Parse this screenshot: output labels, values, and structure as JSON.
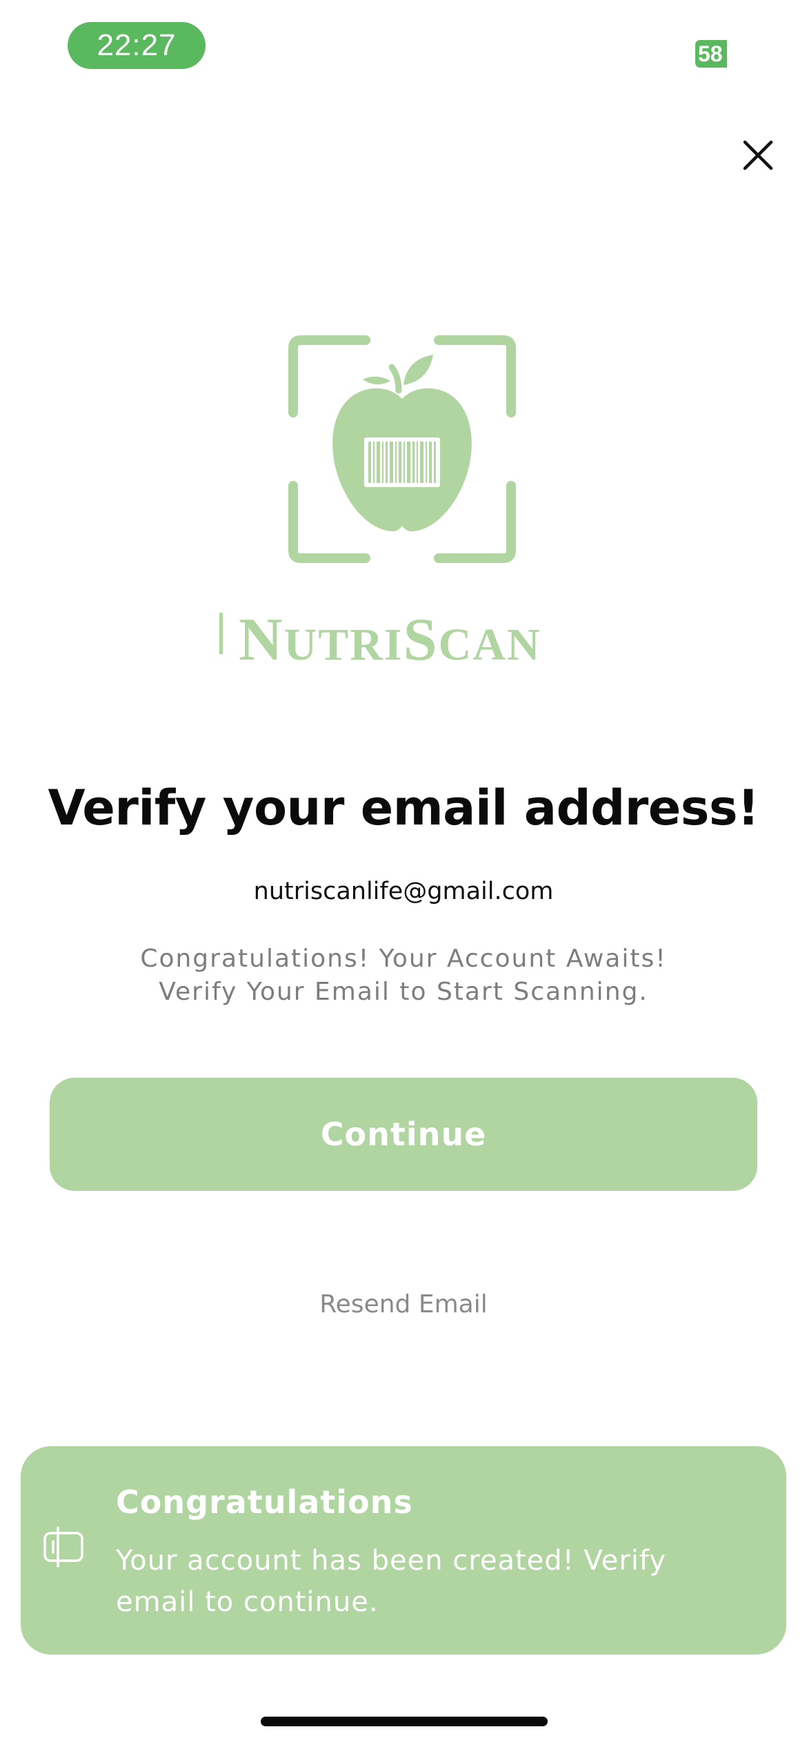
{
  "status_bar": {
    "time": "22:27",
    "battery": "58"
  },
  "brand": {
    "name": "NutriScan",
    "wordmark_big_1": "N",
    "wordmark_small_1": "UTRI",
    "wordmark_big_2": "S",
    "wordmark_small_2": "CAN",
    "color": "#b0d5a0"
  },
  "verify": {
    "title": "Verify your email address!",
    "email": "nutriscanlife@gmail.com",
    "subtitle_line1": "Congratulations! Your Account Awaits!",
    "subtitle_line2": "Verify Your Email to Start Scanning.",
    "continue_label": "Continue",
    "resend_label": "Resend Email"
  },
  "toast": {
    "title": "Congratulations",
    "message": "Your account has been created! Verify email to continue."
  },
  "colors": {
    "accent_green": "#5ab95e",
    "soft_green": "#b0d5a0",
    "muted_text": "#7d7d7d"
  },
  "icons": {
    "close": "close-icon",
    "toast": "feedback-icon",
    "logo": "apple-barcode-scan-icon"
  }
}
